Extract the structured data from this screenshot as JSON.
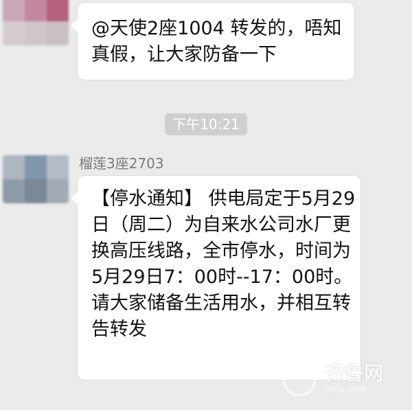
{
  "messages": [
    {
      "text": "@天使2座1004 转发的，唔知真假，让大家防备一下"
    },
    {
      "sender": "榴莲3座2703",
      "text": "【停水通知】 供电局定于5月29日（周二）为自来水公司水厂更换高压线路，全市停水，时间为5月29日7：00时--17：00时。请大家储备生活用水，并相互转告转发"
    }
  ],
  "timestamp": "下午10:21",
  "watermark": {
    "title": "齐鲁网",
    "url": "iqilu.com"
  },
  "avatar_colors": {
    "top": [
      "#c9a7b9",
      "#c2889f",
      "#b5617e",
      "#d6cbd1",
      "#cfc6ca",
      "#c9bfc4"
    ],
    "mid": [
      "#aeb6c2",
      "#8096ad",
      "#b3bbc6",
      "#8d9aa8",
      "#7a8898",
      "#a2aab5"
    ]
  }
}
